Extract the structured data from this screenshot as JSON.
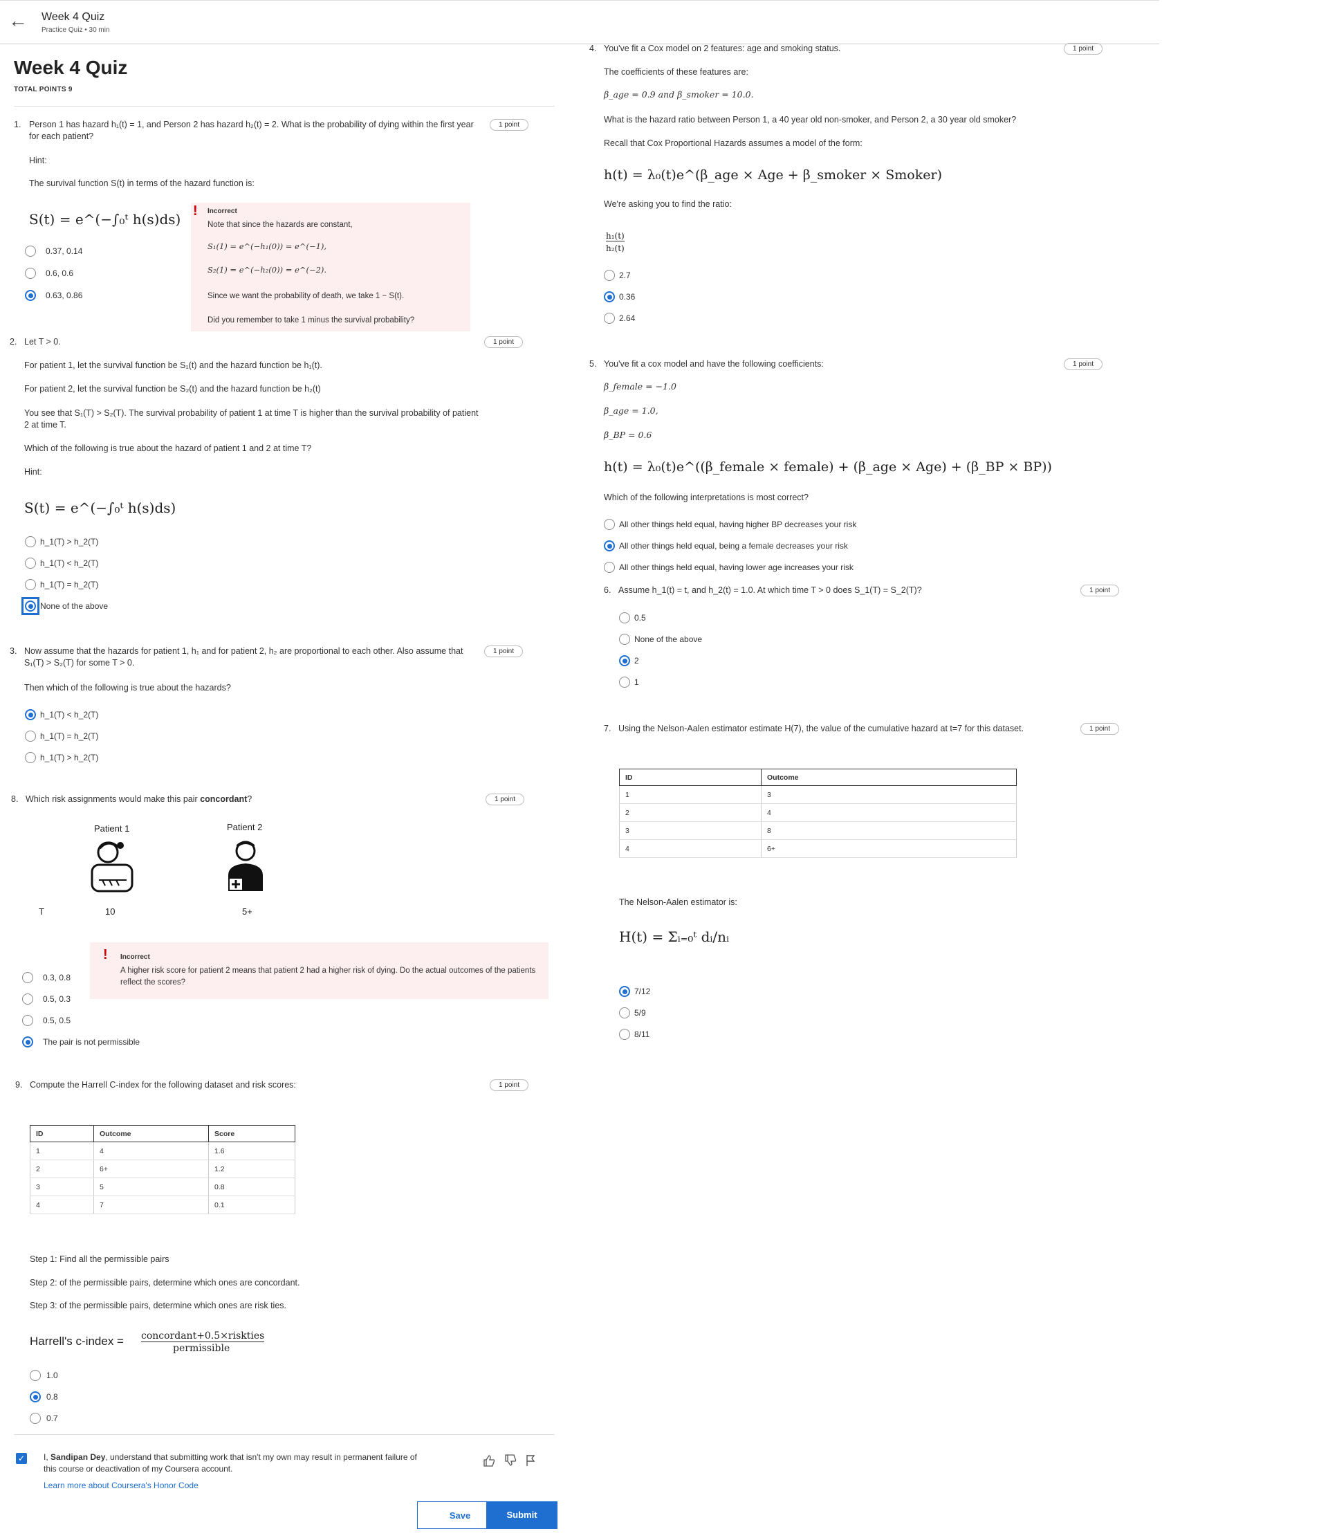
{
  "header": {
    "title": "Week 4 Quiz",
    "subtitle": "Practice Quiz • 30 min"
  },
  "quiz": {
    "title": "Week 4 Quiz",
    "total_points": "TOTAL POINTS 9"
  },
  "points": "1 point",
  "q1": {
    "num": "1.",
    "text": "Person 1 has hazard h₁(t) = 1, and Person 2 has hazard h₂(t) = 2. What is the probability of dying within the first year for each patient?",
    "hint": "Hint:",
    "hint2": "The survival function S(t) in terms of the hazard function is:",
    "formula": "S(t) = e^(−∫₀ᵗ h(s)ds)",
    "options": [
      "0.37, 0.14",
      "0.6, 0.6",
      "0.63, 0.86"
    ],
    "selected": 2,
    "feedback": {
      "title": "Incorrect",
      "lines": [
        "Note that since the hazards are constant,",
        "S₁(1) = e^(−h₁(0)) = e^(−1),",
        "S₂(1) = e^(−h₂(0)) = e^(−2).",
        "Since we want the probability of death, we take 1 − S(t).",
        "Did you remember to take 1 minus the survival probability?"
      ]
    }
  },
  "q2": {
    "num": "2.",
    "text": "Let T > 0.",
    "p1": "For patient 1, let the survival function be S₁(t) and the hazard function be h₁(t).",
    "p2": "For patient 2, let the survival function be S₂(t) and the hazard function be h₂(t)",
    "p3": "You see that S₁(T) > S₂(T). The survival probability of patient 1 at time T is higher than the survival probability of patient 2 at time T.",
    "p4": "Which of the following is true about the hazard of patient 1 and 2 at time T?",
    "hint": "Hint:",
    "formula": "S(t) = e^(−∫₀ᵗ h(s)ds)",
    "options": [
      "h_1(T) > h_2(T)",
      "h_1(T) < h_2(T)",
      "h_1(T) = h_2(T)",
      "None of the above"
    ],
    "selected": 3
  },
  "q3": {
    "num": "3.",
    "text": "Now assume that the hazards for patient 1, h₁ and for patient 2, h₂ are proportional to each other. Also assume that S₁(T) > S₂(T) for some T > 0.",
    "p1": "Then which of the following is true about the hazards?",
    "options": [
      "h_1(T) < h_2(T)",
      "h_1(T) = h_2(T)",
      "h_1(T) > h_2(T)"
    ],
    "selected": 0
  },
  "q8": {
    "num": "8.",
    "text_a": "Which risk assignments would make this pair ",
    "text_b": "concordant",
    "text_c": "?",
    "patient1": "Patient 1",
    "patient2": "Patient 2",
    "t_label": "T",
    "t1": "10",
    "t2": "5+",
    "options": [
      "0.3, 0.8",
      "0.5, 0.3",
      "0.5, 0.5",
      "The pair is not permissible"
    ],
    "selected": 3,
    "feedback": {
      "title": "Incorrect",
      "text": "A higher risk score for patient 2 means that patient 2 had a higher risk of dying. Do the actual outcomes of the patients reflect the scores?"
    }
  },
  "q9": {
    "num": "9.",
    "text": "Compute the Harrell C-index for the following dataset and risk scores:",
    "columns": [
      "ID",
      "Outcome",
      "Score"
    ],
    "rows": [
      [
        "1",
        "4",
        "1.6"
      ],
      [
        "2",
        "6+",
        "1.2"
      ],
      [
        "3",
        "5",
        "0.8"
      ],
      [
        "4",
        "7",
        "0.1"
      ]
    ],
    "step1": "Step 1: Find all the permissible pairs",
    "step2": "Step 2: of the permissible pairs, determine which ones are concordant.",
    "step3": "Step 3: of the permissible pairs, determine which ones are risk ties.",
    "cindex_label": "Harrell's c-index =",
    "cindex_num": "concordant+0.5×riskties",
    "cindex_den": "permissible",
    "options": [
      "1.0",
      "0.8",
      "0.7"
    ],
    "selected": 1
  },
  "q4": {
    "num": "4.",
    "text": "You've fit a Cox model on 2 features: age and smoking status.",
    "p1": "The coefficients of these features are:",
    "p2": "β_age = 0.9 and β_smoker = 10.0.",
    "p3": "What is the hazard ratio between Person 1, a 40 year old non-smoker, and Person 2, a 30 year old smoker?",
    "p4": "Recall that Cox Proportional Hazards assumes a model of the form:",
    "formula": "h(t) = λ₀(t)e^(β_age × Age + β_smoker × Smoker)",
    "p5": "We're asking you to find the ratio:",
    "ratio_num": "h₁(t)",
    "ratio_den": "h₂(t)",
    "options": [
      "2.7",
      "0.36",
      "2.64"
    ],
    "selected": 1
  },
  "q5": {
    "num": "5.",
    "text": "You've fit a cox model and have the following coefficients:",
    "c1": "β_female = −1.0",
    "c2": "β_age = 1.0,",
    "c3": "β_BP = 0.6",
    "formula": "h(t) = λ₀(t)e^((β_female × female) + (β_age × Age) + (β_BP × BP))",
    "p1": "Which of the following interpretations is most correct?",
    "options": [
      "All other things held equal, having higher BP decreases your risk",
      "All other things held equal, being a female decreases your risk",
      "All other things held equal, having lower age increases your risk"
    ],
    "selected": 1
  },
  "q6": {
    "num": "6.",
    "text": "Assume h_1(t) = t, and h_2(t) = 1.0. At which time T > 0 does S_1(T) = S_2(T)?",
    "options": [
      "0.5",
      "None of the above",
      "2",
      "1"
    ],
    "selected": 2
  },
  "q7": {
    "num": "7.",
    "text": "Using the Nelson-Aalen estimator estimate H(7), the value of the cumulative hazard at t=7 for this dataset.",
    "columns": [
      "ID",
      "Outcome"
    ],
    "rows": [
      [
        "1",
        "3"
      ],
      [
        "2",
        "4"
      ],
      [
        "3",
        "8"
      ],
      [
        "4",
        "6+"
      ]
    ],
    "p1": "The Nelson-Aalen estimator is:",
    "formula": "H(t) = Σᵢ₌₀ᵗ dᵢ/nᵢ",
    "options": [
      "7/12",
      "5/9",
      "8/11"
    ],
    "selected": 0
  },
  "honor": {
    "text_a": "I, ",
    "name": "Sandipan Dey",
    "text_b": ", understand that submitting work that isn't my own may result in permanent failure of this course or deactivation of my Coursera account.",
    "link": "Learn more about Coursera's Honor Code"
  },
  "buttons": {
    "save": "Save",
    "submit": "Submit"
  },
  "colors": {
    "accent": "#1f6fd1",
    "error": "#d40000",
    "feedback_bg": "#fdeef0"
  }
}
